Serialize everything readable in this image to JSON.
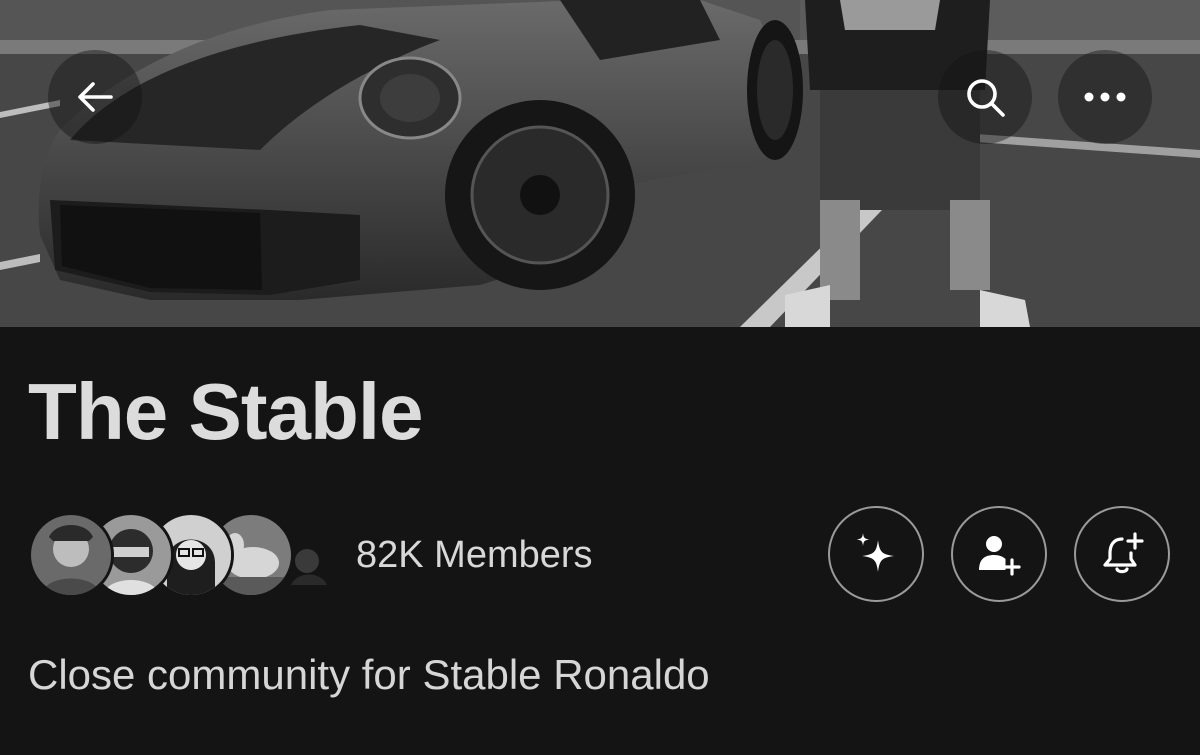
{
  "header": {
    "back_icon": "arrow-left-icon",
    "search_icon": "search-icon",
    "more_icon": "ellipsis-icon"
  },
  "banner": {
    "image": "black-and-white photo of a person standing next to a sports car in a parking lot"
  },
  "community": {
    "title": "The Stable",
    "members_label": "82K Members",
    "description": "Close community for Stable Ronaldo",
    "member_avatar_count": 5
  },
  "actions": [
    {
      "icon": "sparkle-icon"
    },
    {
      "icon": "add-member-icon"
    },
    {
      "icon": "bell-plus-icon"
    }
  ],
  "colors": {
    "background": "#141414",
    "text": "#dcdcdc",
    "button_border": "#9a9a9a"
  }
}
